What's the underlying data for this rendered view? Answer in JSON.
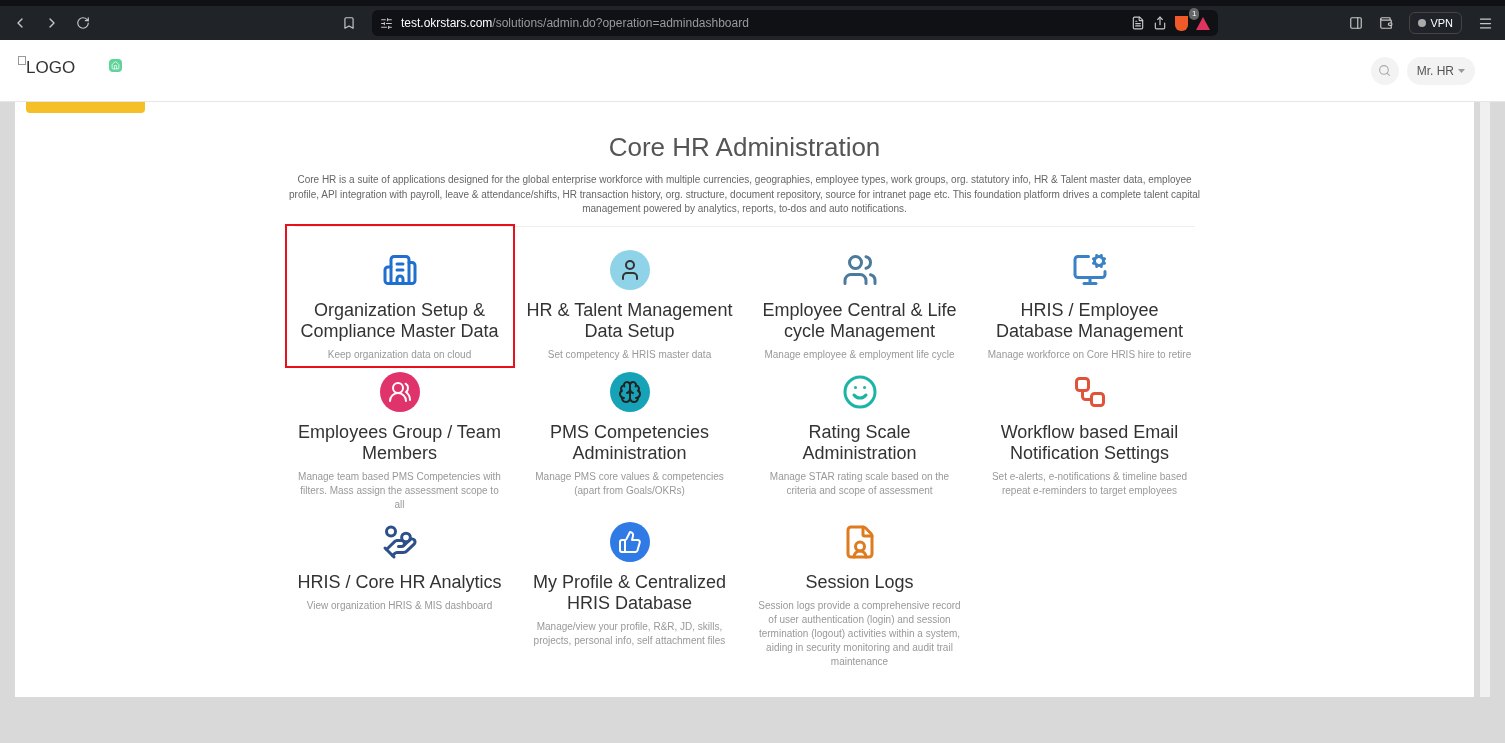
{
  "browser": {
    "url_host": "test.okrstars.com",
    "url_path": "/solutions/admin.do?operation=admindashboard",
    "shield_badge": "1",
    "vpn": "VPN"
  },
  "header": {
    "logo_alt": "LOGO",
    "user_menu": "Mr. HR"
  },
  "page": {
    "title": "Core HR Administration",
    "description": "Core HR is a suite of applications designed for the global enterprise workforce with multiple currencies, geographies, employee types, work groups, org. statutory info, HR & Talent master data, employee profile, API integration with payroll, leave & attendance/shifts, HR transaction history, org. structure, document repository, source for intranet page etc. This foundation platform drives a complete talent capital management powered by analytics, reports, to-dos and auto notifications."
  },
  "tiles": [
    {
      "title": "Organization Setup & Compliance Master Data",
      "description": "Keep organization data on cloud",
      "selected": true
    },
    {
      "title": "HR & Talent Management Data Setup",
      "description": "Set competency & HRIS master data",
      "selected": false
    },
    {
      "title": "Employee Central & Life cycle Management",
      "description": "Manage employee & employment life cycle",
      "selected": false
    },
    {
      "title": "HRIS / Employee Database Management",
      "description": "Manage workforce on Core HRIS hire to retire",
      "selected": false
    },
    {
      "title": "Employees Group / Team Members",
      "description": "Manage team based PMS Competencies with filters. Mass assign the assessment scope to all",
      "selected": false
    },
    {
      "title": "PMS Competencies Administration",
      "description": "Manage PMS core values & competencies (apart from Goals/OKRs)",
      "selected": false
    },
    {
      "title": "Rating Scale Administration",
      "description": "Manage STAR rating scale based on the criteria and scope of assessment",
      "selected": false
    },
    {
      "title": "Workflow based Email Notification Settings",
      "description": "Set e-alerts, e-notifications & timeline based repeat e-reminders to target employees",
      "selected": false
    },
    {
      "title": "HRIS / Core HR Analytics",
      "description": "View organization HRIS & MIS dashboard",
      "selected": false
    },
    {
      "title": "My Profile & Centralized HRIS Database",
      "description": "Manage/view your profile, R&R, JD, skills, projects, personal info, self attachment files",
      "selected": false
    },
    {
      "title": "Session Logs",
      "description": "Session logs provide a comprehensive record of user authentication (login) and session termination (logout) activities within a system, aiding in security monitoring and audit trail maintenance",
      "selected": false
    }
  ]
}
